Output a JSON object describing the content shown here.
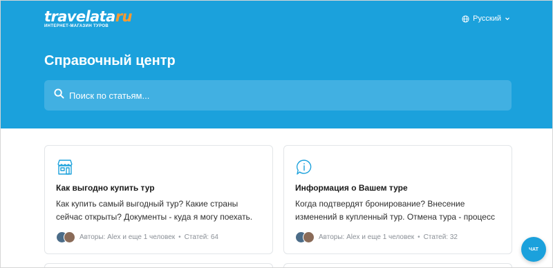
{
  "header": {
    "logo_word": "travelata",
    "logo_suffix": "ru",
    "logo_tagline": "ИНТЕРНЕТ-МАГАЗИН ТУРОВ",
    "language": "Русский",
    "title": "Справочный центр"
  },
  "search": {
    "placeholder": "Поиск по статьям..."
  },
  "collections": [
    {
      "icon": "shop-icon",
      "title": "Как выгодно купить тур",
      "description": "Как купить самый выгодный тур? Какие страны сейчас открыты? Документы - куда я могу поехать. Как найти...",
      "authors": "Авторы: Alex и еще 1 человек",
      "articles": "Статей: 64"
    },
    {
      "icon": "info-icon",
      "title": "Информация о Вашем туре",
      "description": "Когда подтвердят бронирование? Внесение изменений в купленный тур. Отмена тура - процесс и условия....",
      "authors": "Авторы: Alex и еще 1 человек",
      "articles": "Статей: 32"
    }
  ],
  "chat": {
    "label": "ЧАТ"
  },
  "colors": {
    "brand": "#1ba1dc",
    "logo_accent": "#ff9b2f",
    "icon": "#1ba1dc"
  }
}
